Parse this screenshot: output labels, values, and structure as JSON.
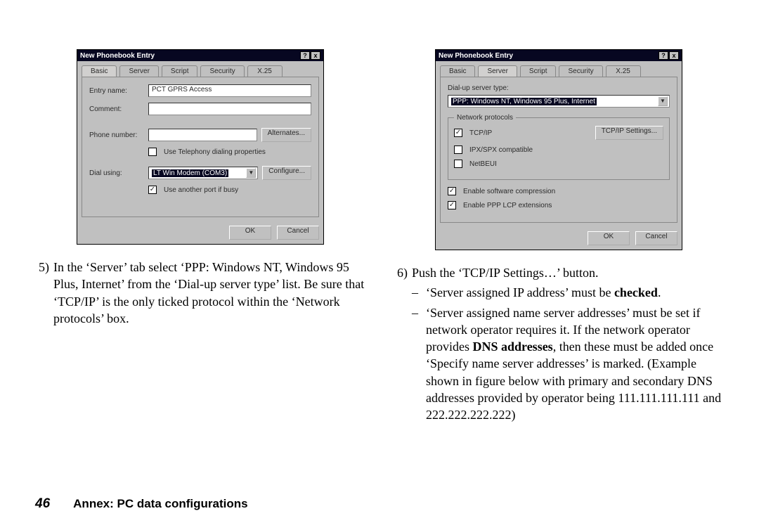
{
  "footer": {
    "page_number": "46",
    "title": "Annex: PC data configurations"
  },
  "dialog_title": "New Phonebook Entry",
  "winbuttons": {
    "help": "?",
    "close": "x"
  },
  "tabs": [
    "Basic",
    "Server",
    "Script",
    "Security",
    "X.25"
  ],
  "buttons": {
    "ok": "OK",
    "cancel": "Cancel"
  },
  "left_dialog": {
    "labels": {
      "entry": "Entry name:",
      "comment": "Comment:",
      "phone": "Phone number:",
      "dial": "Dial using:"
    },
    "entry_value": "PCT GPRS Access",
    "comment_value": "",
    "phone_value": "",
    "alternates_btn": "Alternates...",
    "chk_telephony": "Use Telephony dialing properties",
    "chk_telephony_checked": false,
    "dial_value": "LT Win Modem (COM3)",
    "configure_btn": "Configure...",
    "chk_another": "Use another port if busy",
    "chk_another_checked": true
  },
  "right_dialog": {
    "label_server_type": "Dial-up server type:",
    "server_type_value": "PPP: Windows NT, Windows 95 Plus, Internet",
    "group_label": "Network protocols",
    "proto_tcpip": "TCP/IP",
    "proto_tcpip_checked": true,
    "proto_ipx": "IPX/SPX compatible",
    "proto_ipx_checked": false,
    "proto_netbeui": "NetBEUI",
    "proto_netbeui_checked": false,
    "tcpip_settings_btn": "TCP/IP Settings...",
    "chk_compression": "Enable software compression",
    "chk_compression_checked": true,
    "chk_lcp": "Enable PPP LCP extensions",
    "chk_lcp_checked": true
  },
  "step5": {
    "num": "5)",
    "text": "In the ‘Server’ tab select ‘PPP: Windows NT, Windows 95 Plus, Internet’ from the ‘Dial-up server type’ list. Be sure that ‘TCP/IP’ is the only ticked protocol within the ‘Network protocols’ box."
  },
  "step6": {
    "num": "6)",
    "text": "Push the ‘TCP/IP Settings…’ button.",
    "sub1_pre": "‘Server assigned IP address’ must be ",
    "sub1_bold": "checked",
    "sub1_post": ".",
    "sub2_pre": "‘Server assigned name server addresses’ must be set if network operator requires it. If the network operator provides ",
    "sub2_bold": "DNS addresses",
    "sub2_post": ", then these must be added once ‘Specify name server addresses’ is marked. (Example shown in figure below with primary and secondary DNS addresses provided by operator being 111.111.111.111 and 222.222.222.222)"
  }
}
